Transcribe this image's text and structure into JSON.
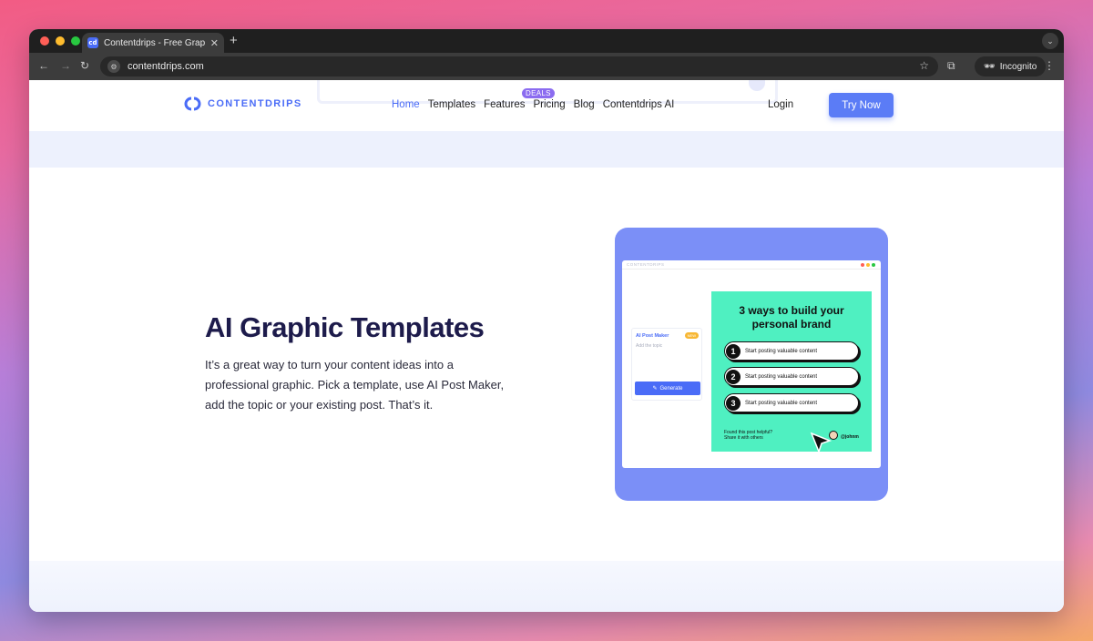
{
  "browser": {
    "tab_title": "Contentdrips - Free Graphic Design",
    "tab_favicon_text": "cd",
    "url": "contentdrips.com",
    "incognito_label": "Incognito"
  },
  "site": {
    "logo_text": "CONTENTDRIPS",
    "nav": [
      {
        "label": "Home",
        "active": true
      },
      {
        "label": "Templates"
      },
      {
        "label": "Features"
      },
      {
        "label": "Pricing"
      },
      {
        "label": "Blog"
      },
      {
        "label": "Contentdrips AI"
      }
    ],
    "deals_badge": "DEALS",
    "login_label": "Login",
    "cta_label": "Try Now"
  },
  "hero": {
    "title": "AI Graphic Templates",
    "text": "It’s a great way to turn your content ideas into a professional graphic. Pick a template, use AI Post Maker, add the topic or your existing post. That’s it."
  },
  "illustration": {
    "app_label": "CONTENTDRIPS",
    "panel_title": "AI Post Maker",
    "panel_badge": "NEW",
    "panel_placeholder": "Add the topic",
    "panel_button": "Generate",
    "card_title_line1": "3 ways to build your",
    "card_title_line2": "personal brand",
    "steps": [
      {
        "num": "1",
        "text": "Start posting valuable content"
      },
      {
        "num": "2",
        "text": "Start posting valuable content"
      },
      {
        "num": "3",
        "text": "Start posting valuable content"
      }
    ],
    "card_foot_line1": "Found this post helpful?",
    "card_foot_line2": "Share it with others",
    "card_handle": "@johnm"
  },
  "colors": {
    "brand": "#4a6cf7",
    "illustration_bg": "#7b8ff7",
    "card_bg": "#4ff0c1",
    "title": "#1d1b4b"
  }
}
